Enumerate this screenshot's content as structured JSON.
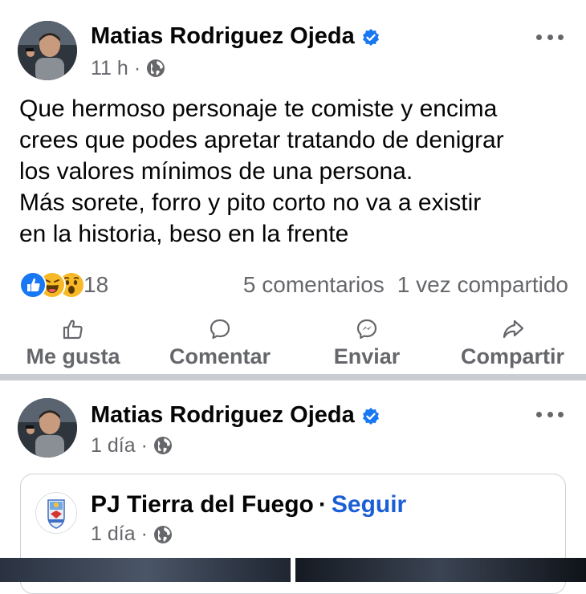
{
  "post1": {
    "author": "Matias Rodriguez Ojeda",
    "time": "11 h",
    "dot": "·",
    "text": "Que hermoso personaje te comiste y encima\ncrees que podes apretar tratando de denigrar\nlos valores mínimos de una persona.\nMás sorete, forro y pito corto no va a existir\nen la historia, beso en la frente",
    "reaction_count": "18",
    "comments": "5 comentarios",
    "shares": "1 vez compartido",
    "reactions": [
      "like-reaction",
      "haha-reaction",
      "wow-reaction"
    ]
  },
  "actions": {
    "like": "Me gusta",
    "comment": "Comentar",
    "send": "Enviar",
    "share": "Compartir"
  },
  "post2": {
    "author": "Matias Rodriguez Ojeda",
    "time": "1 día",
    "dot": "·",
    "shared_page": {
      "name": "PJ Tierra del Fuego",
      "sep": "·",
      "follow": "Seguir",
      "time": "1 día",
      "dot": "·"
    }
  },
  "colors": {
    "accent": "#1b5fd6",
    "verified": "#1877f2",
    "secondary_text": "#65676b",
    "separator": "#c9ccd1"
  }
}
